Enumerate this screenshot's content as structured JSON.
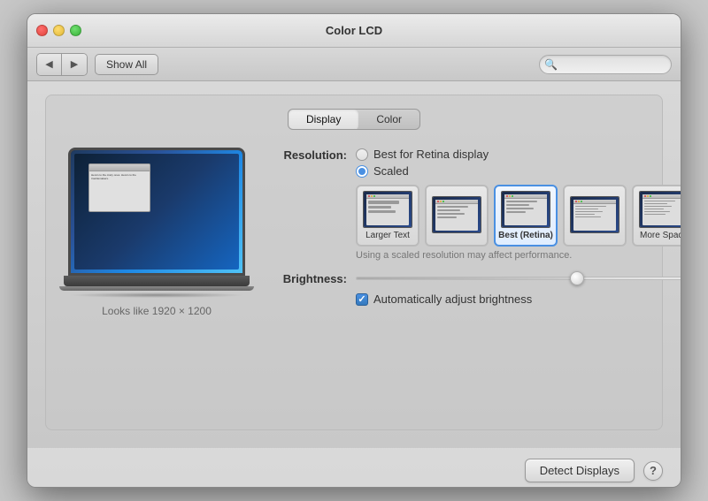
{
  "window": {
    "title": "Color LCD",
    "traffic_lights": [
      "close",
      "minimize",
      "maximize"
    ]
  },
  "toolbar": {
    "show_all_label": "Show All",
    "search_placeholder": ""
  },
  "tabs": [
    {
      "id": "display",
      "label": "Display",
      "active": true
    },
    {
      "id": "color",
      "label": "Color",
      "active": false
    }
  ],
  "display": {
    "resolution_label": "Resolution:",
    "resolution_options": [
      {
        "id": "best_retina",
        "label": "Best for Retina display",
        "selected": false
      },
      {
        "id": "scaled",
        "label": "Scaled",
        "selected": true
      }
    ],
    "scale_options": [
      {
        "id": "larger_text",
        "label": "Larger Text",
        "bold": false
      },
      {
        "id": "medium1",
        "label": "",
        "bold": false
      },
      {
        "id": "best_retina",
        "label": "Best (Retina)",
        "bold": true,
        "selected": true
      },
      {
        "id": "medium2",
        "label": "",
        "bold": false
      },
      {
        "id": "more_space",
        "label": "More Space",
        "bold": false
      }
    ],
    "perf_note": "Using a scaled resolution may affect performance.",
    "brightness_label": "Brightness:",
    "brightness_value": 65,
    "auto_brightness_label": "Automatically adjust brightness",
    "auto_brightness_checked": true,
    "laptop_subtitle": "Looks like 1920 × 1200"
  },
  "footer": {
    "detect_label": "Detect Displays",
    "help_label": "?"
  }
}
